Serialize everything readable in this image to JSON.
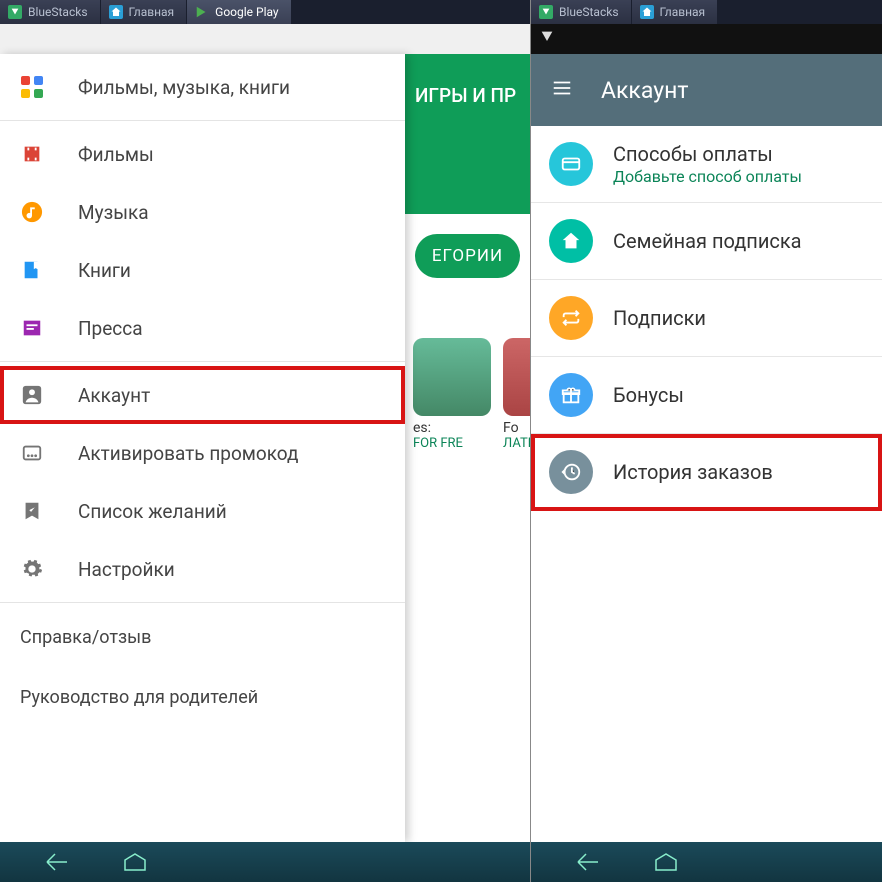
{
  "left": {
    "tabs": [
      {
        "label": "BlueStacks"
      },
      {
        "label": "Главная"
      },
      {
        "label": "Google Play"
      }
    ],
    "peek_header": "ИГРЫ И ПР",
    "peek_chip": "ЕГОРИИ",
    "drawer": {
      "media_header": "Фильмы, музыка, книги",
      "items": [
        {
          "label": "Фильмы"
        },
        {
          "label": "Музыка"
        },
        {
          "label": "Книги"
        },
        {
          "label": "Пресса"
        }
      ],
      "utility": [
        {
          "label": "Аккаунт"
        },
        {
          "label": "Активировать промокод"
        },
        {
          "label": "Список желаний"
        },
        {
          "label": "Настройки"
        }
      ],
      "footer": [
        {
          "label": "Справка/отзыв"
        },
        {
          "label": "Руководство для родителей"
        }
      ]
    },
    "cards": [
      {
        "title_frag": "es:",
        "sub": "For Fre"
      },
      {
        "title_frag": "Fo",
        "sub": "ЛАТНО"
      }
    ]
  },
  "right": {
    "tabs": [
      {
        "label": "BlueStacks"
      },
      {
        "label": "Главная"
      }
    ],
    "header": "Аккаунт",
    "items": [
      {
        "label": "Способы оплаты",
        "sub": "Добавьте способ оплаты",
        "color": "#26c6da"
      },
      {
        "label": "Семейная подписка",
        "color": "#00bfa5"
      },
      {
        "label": "Подписки",
        "color": "#ffa726"
      },
      {
        "label": "Бонусы",
        "color": "#42a5f5"
      },
      {
        "label": "История заказов",
        "color": "#78909c"
      }
    ]
  }
}
